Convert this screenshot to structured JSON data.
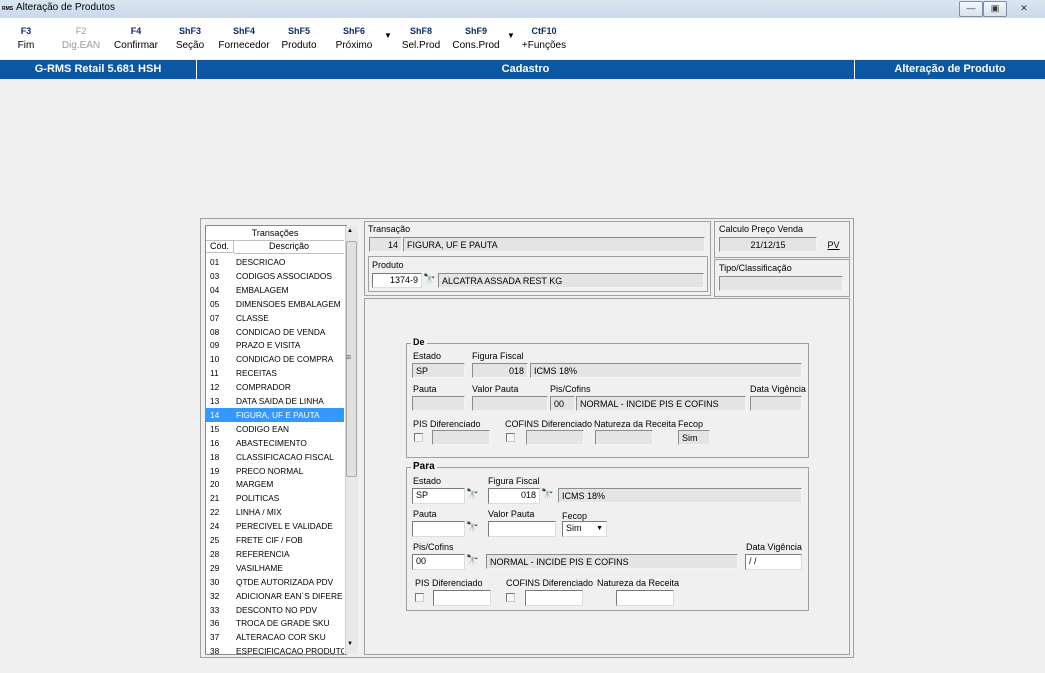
{
  "window": {
    "title": "Alteração de Produtos",
    "logo": "RMS",
    "controls": {
      "minimize": "—",
      "restore": "▣",
      "close": "✕"
    }
  },
  "toolbar": {
    "buttons": [
      {
        "key": "F3",
        "label": "Fim",
        "enabled": true
      },
      {
        "key": "F2",
        "label": "Dig.EAN",
        "enabled": false
      },
      {
        "key": "F4",
        "label": "Confirmar",
        "enabled": true
      },
      {
        "key": "ShF3",
        "label": "Seção",
        "enabled": true
      },
      {
        "key": "ShF4",
        "label": "Fornecedor",
        "enabled": true
      },
      {
        "key": "ShF5",
        "label": "Produto",
        "enabled": true
      },
      {
        "key": "ShF6",
        "label": "Próximo",
        "enabled": true
      },
      {
        "key": "ShF8",
        "label": "Sel.Prod",
        "enabled": true
      },
      {
        "key": "ShF9",
        "label": "Cons.Prod",
        "enabled": true
      },
      {
        "key": "CtF10",
        "label": "+Funções",
        "enabled": true
      }
    ],
    "dropdown_glyph": "▼"
  },
  "header": {
    "left": "G-RMS Retail 5.681 HSH",
    "center": "Cadastro",
    "right": "Alteração de Produto"
  },
  "transacoes": {
    "title": "Transações",
    "col_cod": "Cód.",
    "col_desc": "Descrição",
    "selected_code": "14",
    "rows": [
      {
        "cod": "01",
        "desc": "DESCRICAO"
      },
      {
        "cod": "03",
        "desc": "CODIGOS ASSOCIADOS"
      },
      {
        "cod": "04",
        "desc": "EMBALAGEM"
      },
      {
        "cod": "05",
        "desc": "DIMENSOES EMBALAGEM"
      },
      {
        "cod": "07",
        "desc": "CLASSE"
      },
      {
        "cod": "08",
        "desc": "CONDICAO DE VENDA"
      },
      {
        "cod": "09",
        "desc": "PRAZO E VISITA"
      },
      {
        "cod": "10",
        "desc": "CONDICAO DE COMPRA"
      },
      {
        "cod": "11",
        "desc": "RECEITAS"
      },
      {
        "cod": "12",
        "desc": "COMPRADOR"
      },
      {
        "cod": "13",
        "desc": "DATA SAIDA DE LINHA"
      },
      {
        "cod": "14",
        "desc": "FIGURA, UF E PAUTA"
      },
      {
        "cod": "15",
        "desc": "CODIGO EAN"
      },
      {
        "cod": "16",
        "desc": "ABASTECIMENTO"
      },
      {
        "cod": "18",
        "desc": "CLASSIFICACAO FISCAL"
      },
      {
        "cod": "19",
        "desc": "PRECO NORMAL"
      },
      {
        "cod": "20",
        "desc": "MARGEM"
      },
      {
        "cod": "21",
        "desc": "POLITICAS"
      },
      {
        "cod": "22",
        "desc": "LINHA / MIX"
      },
      {
        "cod": "24",
        "desc": "PERECIVEL E VALIDADE"
      },
      {
        "cod": "25",
        "desc": "FRETE CIF / FOB"
      },
      {
        "cod": "28",
        "desc": "REFERENCIA"
      },
      {
        "cod": "29",
        "desc": "VASILHAME"
      },
      {
        "cod": "30",
        "desc": "QTDE AUTORIZADA PDV"
      },
      {
        "cod": "32",
        "desc": "ADICIONAR EAN´S DIFERE"
      },
      {
        "cod": "33",
        "desc": "DESCONTO NO PDV"
      },
      {
        "cod": "36",
        "desc": "TROCA DE GRADE SKU"
      },
      {
        "cod": "37",
        "desc": "ALTERACAO COR SKU"
      },
      {
        "cod": "38",
        "desc": "ESPECIFICACAO PRODUTO"
      }
    ]
  },
  "transacao": {
    "label": "Transação",
    "code": "14",
    "desc": "FIGURA, UF E PAUTA"
  },
  "produto": {
    "label": "Produto",
    "code": "1374-9",
    "desc": "ALCATRA ASSADA REST KG"
  },
  "calculo": {
    "label": "Calculo Preço Venda",
    "date": "21/12/15",
    "pv_button": "PV"
  },
  "tipo": {
    "label": "Tipo/Classificação",
    "value": ""
  },
  "de": {
    "legend": "De",
    "estado_label": "Estado",
    "estado": "SP",
    "figura_label": "Figura Fiscal",
    "figura_code": "018",
    "figura_desc": "ICMS 18%",
    "pauta_label": "Pauta",
    "pauta": "",
    "valor_pauta_label": "Valor Pauta",
    "valor_pauta": "",
    "pis_cofins_label": "Pis/Cofins",
    "pis_cofins_code": "00",
    "pis_cofins_desc": "NORMAL - INCIDE PIS E COFINS",
    "data_vigencia_label": "Data Vigência",
    "data_vigencia": "",
    "pis_dif_label": "PIS Diferenciado",
    "cofins_dif_label": "COFINS Diferenciado",
    "natureza_label": "Natureza da Receita",
    "fecop_label": "Fecop",
    "fecop": "Sim"
  },
  "para": {
    "legend": "Para",
    "estado_label": "Estado",
    "estado": "SP",
    "figura_label": "Figura Fiscal",
    "figura_code": "018",
    "figura_desc": "ICMS 18%",
    "pauta_label": "Pauta",
    "pauta": "",
    "valor_pauta_label": "Valor Pauta",
    "valor_pauta": "",
    "fecop_label": "Fecop",
    "fecop": "Sim",
    "pis_cofins_label": "Pis/Cofins",
    "pis_cofins_code": "00",
    "pis_cofins_desc": "NORMAL - INCIDE PIS E COFINS",
    "data_vigencia_label": "Data Vigência",
    "data_vigencia": " / /",
    "pis_dif_label": "PIS Diferenciado",
    "cofins_dif_label": "COFINS Diferenciado",
    "natureza_label": "Natureza da Receita"
  },
  "icons": {
    "binoculars": "🔭",
    "scroll_up": "▲",
    "scroll_down": "▼",
    "scroll_grip": "≡",
    "select_arrow": "▼"
  }
}
